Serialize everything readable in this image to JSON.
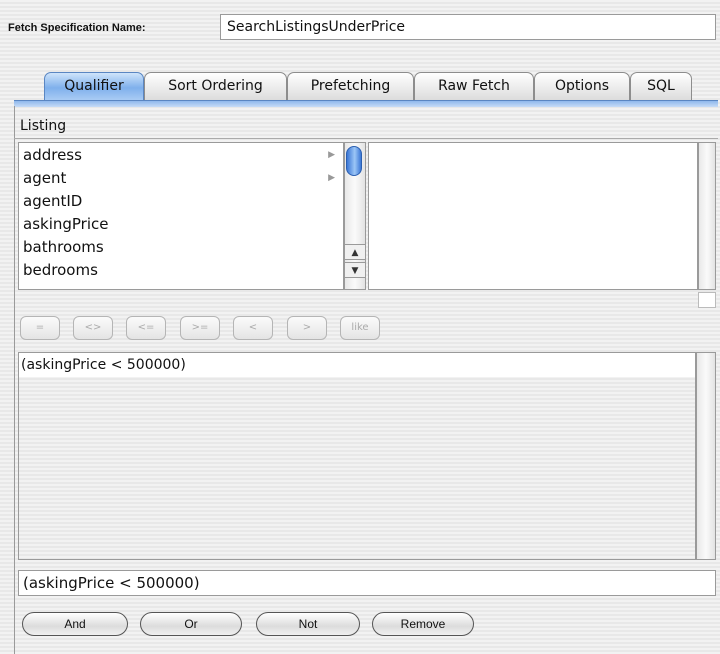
{
  "header": {
    "name_label": "Fetch Specification Name:",
    "name_value": "SearchListingsUnderPrice"
  },
  "tabs": [
    {
      "label": "Qualifier",
      "active": true
    },
    {
      "label": "Sort Ordering",
      "active": false
    },
    {
      "label": "Prefetching",
      "active": false
    },
    {
      "label": "Raw Fetch",
      "active": false
    },
    {
      "label": "Options",
      "active": false
    },
    {
      "label": "SQL",
      "active": false
    }
  ],
  "entity": "Listing",
  "attributes": [
    {
      "label": "address",
      "has_children": true
    },
    {
      "label": "agent",
      "has_children": true
    },
    {
      "label": "agentID",
      "has_children": false
    },
    {
      "label": "askingPrice",
      "has_children": false
    },
    {
      "label": "bathrooms",
      "has_children": false
    },
    {
      "label": "bedrooms",
      "has_children": false
    }
  ],
  "operators": [
    "=",
    "<>",
    "<=",
    ">=",
    "<",
    ">",
    "like"
  ],
  "qualifier_text": "(askingPrice < 500000)",
  "expression": "(askingPrice < 500000)",
  "logic_buttons": [
    "And",
    "Or",
    "Not",
    "Remove"
  ],
  "colors": {
    "tab_active": "#7fb0ec",
    "scroll_thumb": "#3b77d6"
  }
}
